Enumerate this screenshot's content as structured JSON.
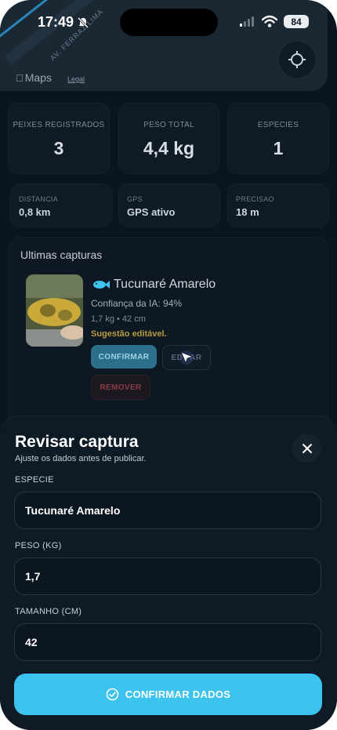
{
  "status_bar": {
    "time": "17:49",
    "battery": "84"
  },
  "map": {
    "street_label": "AV. FERRAZ LIMA",
    "logo_text": "Maps",
    "legal_text": "Legal"
  },
  "stats": [
    {
      "label": "PEIXES REGISTRADOS",
      "value": "3"
    },
    {
      "label": "PESO TOTAL",
      "value": "4,4 kg"
    },
    {
      "label": "ESPECIES",
      "value": "1"
    }
  ],
  "info": [
    {
      "label": "DISTANCIA",
      "value": "0,8 km"
    },
    {
      "label": "GPS",
      "value": "GPS ativo"
    },
    {
      "label": "PRECISAO",
      "value": "18 m"
    }
  ],
  "captures": {
    "title": "Ultimas capturas",
    "item": {
      "name": "Tucunaré Amarelo",
      "confidence": "Confiança da IA: 94%",
      "meta": "1,7 kg • 42 cm",
      "hint": "Sugestão editável.",
      "confirm_label": "CONFIRMAR",
      "edit_label": "EDITAR",
      "remove_label": "REMOVER"
    }
  },
  "sheet": {
    "title": "Revisar captura",
    "subtitle": "Ajuste os dados antes de publicar.",
    "fields": [
      {
        "label": "ESPECIE",
        "value": "Tucunaré Amarelo"
      },
      {
        "label": "PESO (KG)",
        "value": "1,7"
      },
      {
        "label": "TAMANHO (CM)",
        "value": "42"
      }
    ],
    "confirm_label": "CONFIRMAR DADOS"
  },
  "colors": {
    "accent": "#3cc3ee",
    "background": "#0b1520",
    "warning": "#b69b3e",
    "danger": "#8a3c44"
  }
}
